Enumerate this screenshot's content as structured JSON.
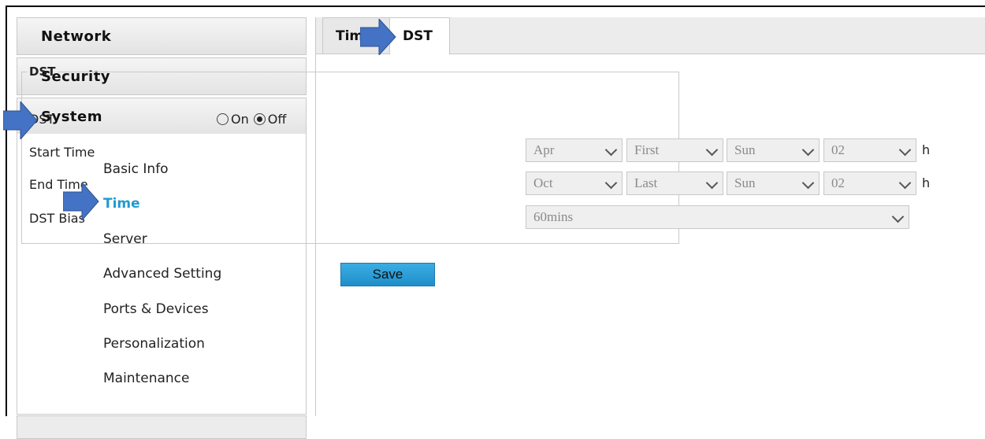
{
  "sidebar": {
    "sections": [
      {
        "label": "Network"
      },
      {
        "label": "Security"
      },
      {
        "label": "System"
      }
    ],
    "items": [
      {
        "label": "Basic Info"
      },
      {
        "label": "Time"
      },
      {
        "label": "Server"
      },
      {
        "label": "Advanced Setting"
      },
      {
        "label": "Ports & Devices"
      },
      {
        "label": "Personalization"
      },
      {
        "label": "Maintenance"
      }
    ],
    "active_item": "Time"
  },
  "tabs": [
    {
      "label": "Tim"
    },
    {
      "label": "DST"
    }
  ],
  "dst_section": {
    "legend": "DST",
    "dst_label": "DST",
    "dst_options": [
      {
        "label": "On",
        "checked": false
      },
      {
        "label": "Off",
        "checked": true
      }
    ],
    "start_time": {
      "label": "Start Time",
      "month": "Apr",
      "week": "First",
      "day": "Sun",
      "hour": "02",
      "unit": "h"
    },
    "end_time": {
      "label": "End Time",
      "month": "Oct",
      "week": "Last",
      "day": "Sun",
      "hour": "02",
      "unit": "h"
    },
    "dst_bias": {
      "label": "DST Bias",
      "value": "60mins"
    }
  },
  "save_label": "Save",
  "colors": {
    "accent": "#1f9bcf",
    "save_button": "#2a9fd8",
    "annotation_arrow": "#4472c4"
  }
}
